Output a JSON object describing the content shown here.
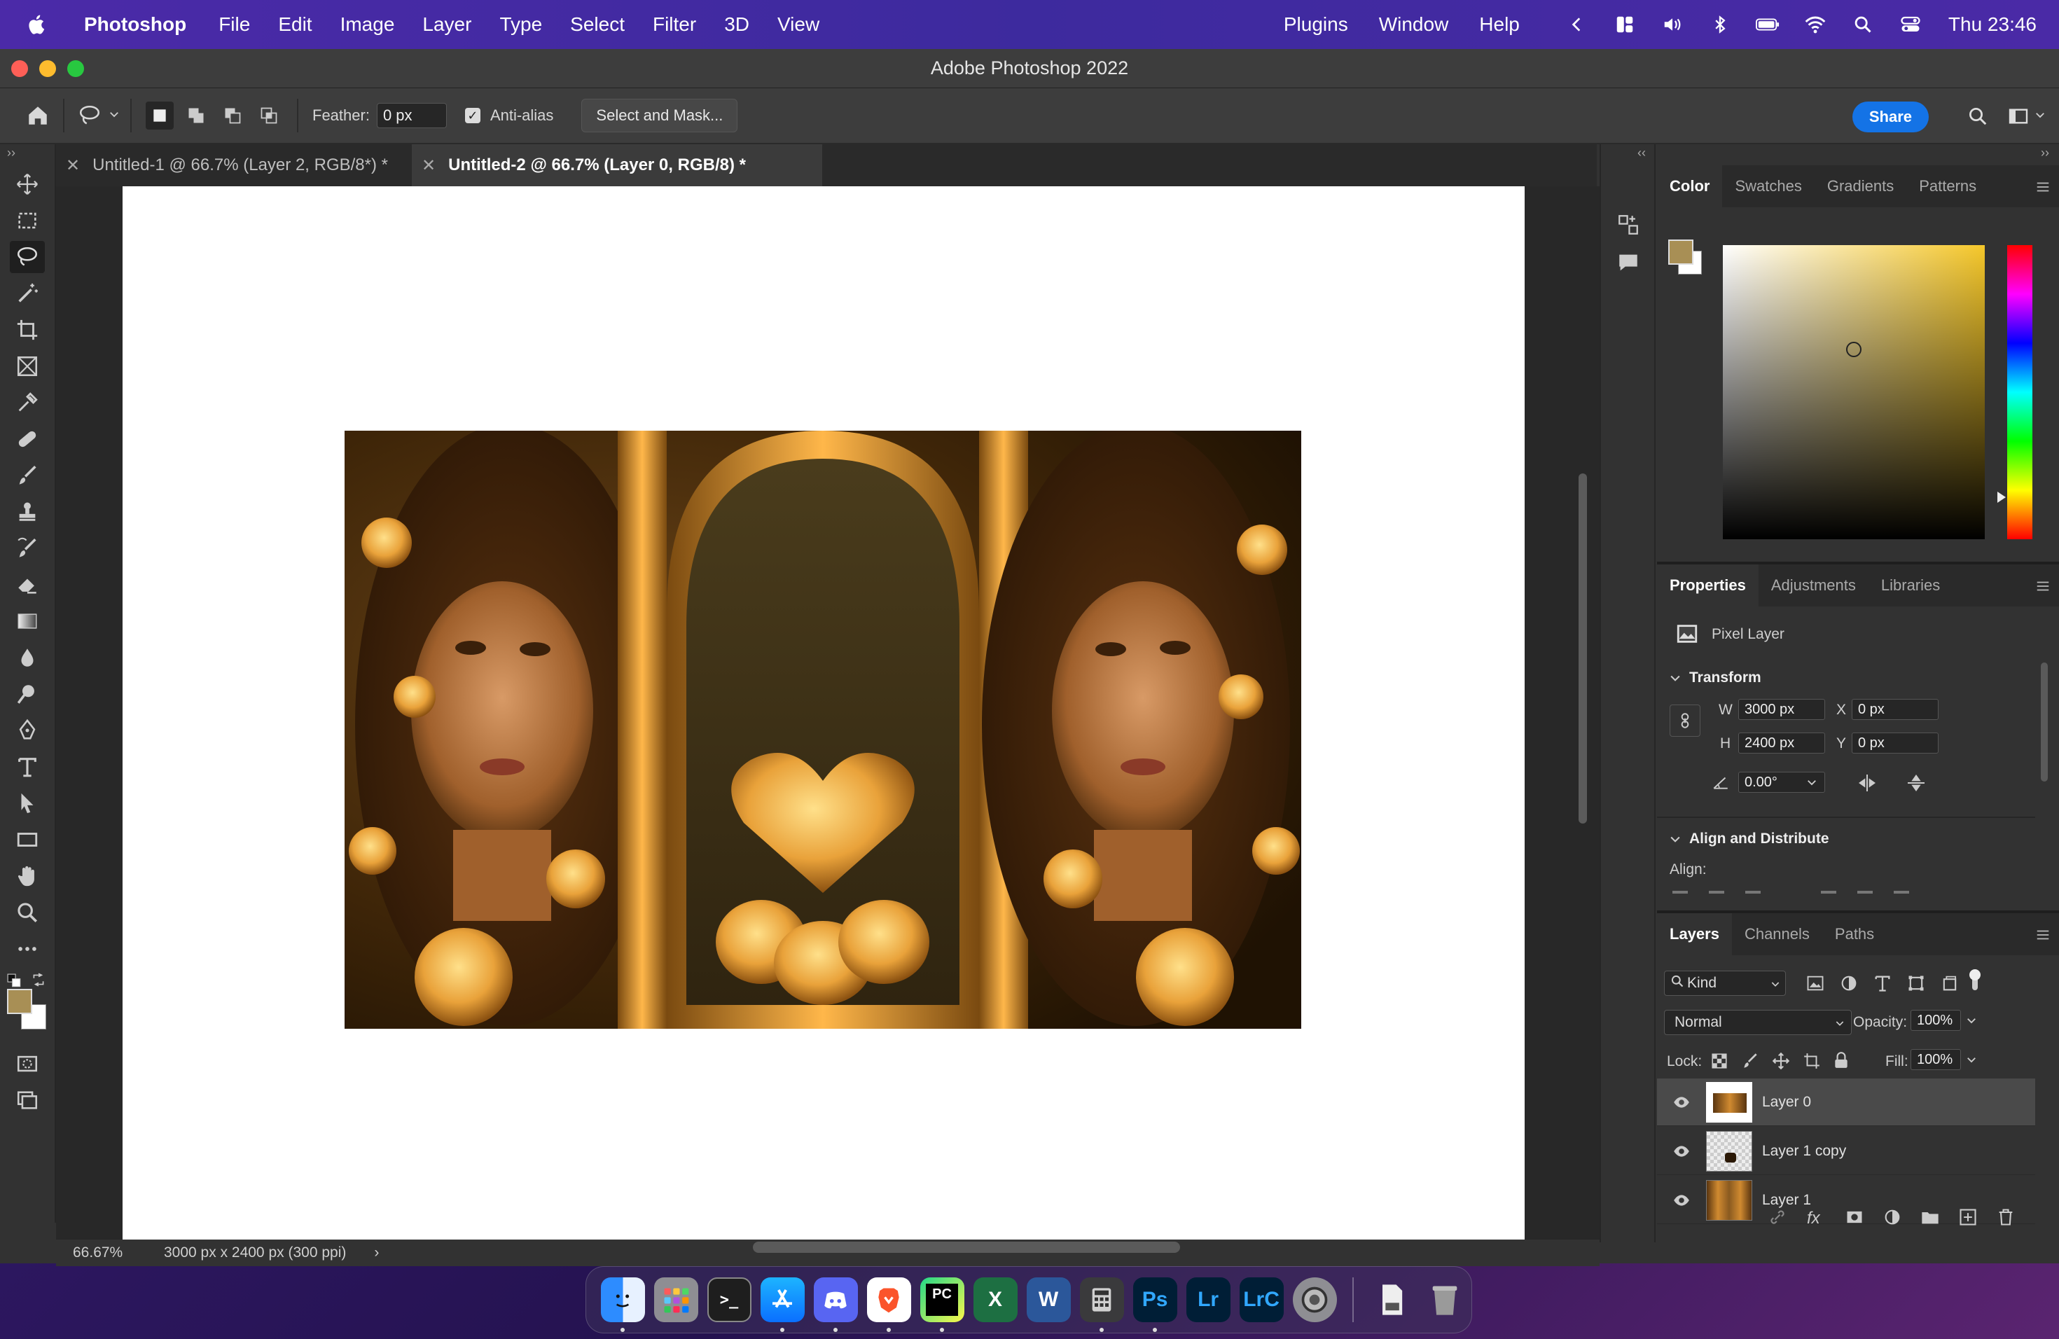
{
  "menubar": {
    "app_name": "Photoshop",
    "items": [
      "File",
      "Edit",
      "Image",
      "Layer",
      "Type",
      "Select",
      "Filter",
      "3D",
      "View"
    ],
    "right_items": [
      "Plugins",
      "Window",
      "Help"
    ],
    "clock": "Thu 23:46"
  },
  "window": {
    "title": "Adobe Photoshop 2022"
  },
  "options": {
    "feather_label": "Feather:",
    "feather_value": "0 px",
    "antialias_label": "Anti-alias",
    "select_mask_label": "Select and Mask...",
    "share_label": "Share"
  },
  "tabs": [
    {
      "label": "Untitled-1 @ 66.7% (Layer 2, RGB/8*) *",
      "active": false
    },
    {
      "label": "Untitled-2 @ 66.7% (Layer 0, RGB/8) *",
      "active": true
    }
  ],
  "status": {
    "zoom": "66.67%",
    "doc_info": "3000 px x 2400 px (300 ppi)"
  },
  "colors": {
    "foreground": "#a88f55",
    "background": "#ffffff",
    "accent": "#1473e6"
  },
  "color_panel": {
    "tabs": [
      "Color",
      "Swatches",
      "Gradients",
      "Patterns"
    ],
    "active": "Color"
  },
  "properties_panel": {
    "tabs": [
      "Properties",
      "Adjustments",
      "Libraries"
    ],
    "layer_kind": "Pixel Layer",
    "transform_label": "Transform",
    "w_label": "W",
    "w_value": "3000 px",
    "h_label": "H",
    "h_value": "2400 px",
    "x_label": "X",
    "x_value": "0 px",
    "y_label": "Y",
    "y_value": "0 px",
    "angle_value": "0.00°",
    "align_section": "Align and Distribute",
    "align_label": "Align:"
  },
  "layers_panel": {
    "tabs": [
      "Layers",
      "Channels",
      "Paths"
    ],
    "filter_kind": "Kind",
    "blend_mode": "Normal",
    "opacity_label": "Opacity:",
    "opacity_value": "100%",
    "lock_label": "Lock:",
    "fill_label": "Fill:",
    "fill_value": "100%",
    "layers": [
      {
        "name": "Layer 0",
        "selected": true
      },
      {
        "name": "Layer 1 copy",
        "selected": false
      },
      {
        "name": "Layer 1",
        "selected": false
      }
    ]
  },
  "dock": {
    "apps": [
      "Finder",
      "Launchpad",
      "Terminal",
      "App Store",
      "Discord",
      "Brave",
      "PyCharm",
      "Excel",
      "Word",
      "Calculator",
      "Ps",
      "Lr",
      "LrC",
      "Settings",
      "Document",
      "Trash"
    ]
  }
}
